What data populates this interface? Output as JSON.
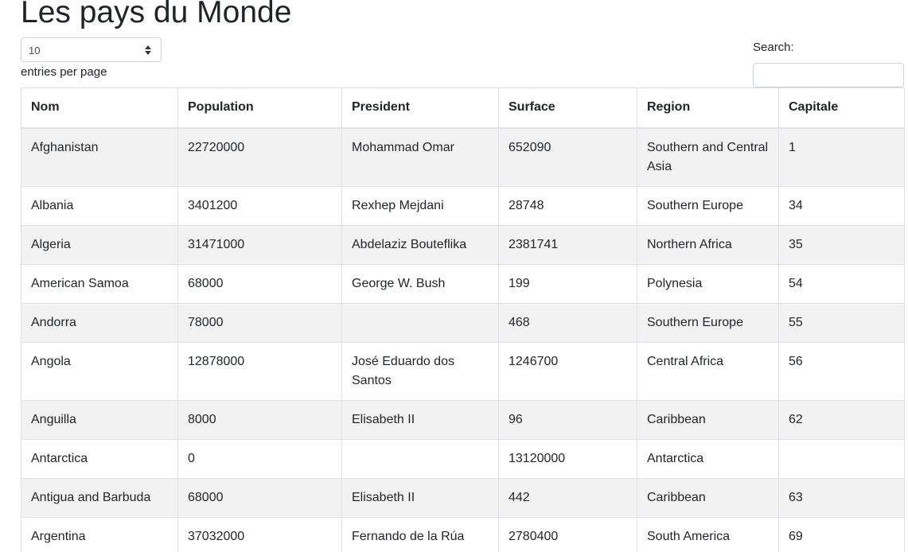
{
  "page": {
    "title": "Les pays du Monde"
  },
  "length_control": {
    "selected": "10",
    "label": "entries per page",
    "icon": "updown-arrows-icon"
  },
  "search": {
    "label": "Search:",
    "value": "",
    "placeholder": ""
  },
  "table": {
    "columns": [
      "Nom",
      "Population",
      "President",
      "Surface",
      "Region",
      "Capitale"
    ],
    "rows": [
      [
        "Afghanistan",
        "22720000",
        "Mohammad Omar",
        "652090",
        "Southern and Central Asia",
        "1"
      ],
      [
        "Albania",
        "3401200",
        "Rexhep Mejdani",
        "28748",
        "Southern Europe",
        "34"
      ],
      [
        "Algeria",
        "31471000",
        "Abdelaziz Bouteflika",
        "2381741",
        "Northern Africa",
        "35"
      ],
      [
        "American Samoa",
        "68000",
        "George W. Bush",
        "199",
        "Polynesia",
        "54"
      ],
      [
        "Andorra",
        "78000",
        "",
        "468",
        "Southern Europe",
        "55"
      ],
      [
        "Angola",
        "12878000",
        "José Eduardo dos Santos",
        "1246700",
        "Central Africa",
        "56"
      ],
      [
        "Anguilla",
        "8000",
        "Elisabeth II",
        "96",
        "Caribbean",
        "62"
      ],
      [
        "Antarctica",
        "0",
        "",
        "13120000",
        "Antarctica",
        ""
      ],
      [
        "Antigua and Barbuda",
        "68000",
        "Elisabeth II",
        "442",
        "Caribbean",
        "63"
      ],
      [
        "Argentina",
        "37032000",
        "Fernando de la Rúa",
        "2780400",
        "South America",
        "69"
      ]
    ]
  }
}
